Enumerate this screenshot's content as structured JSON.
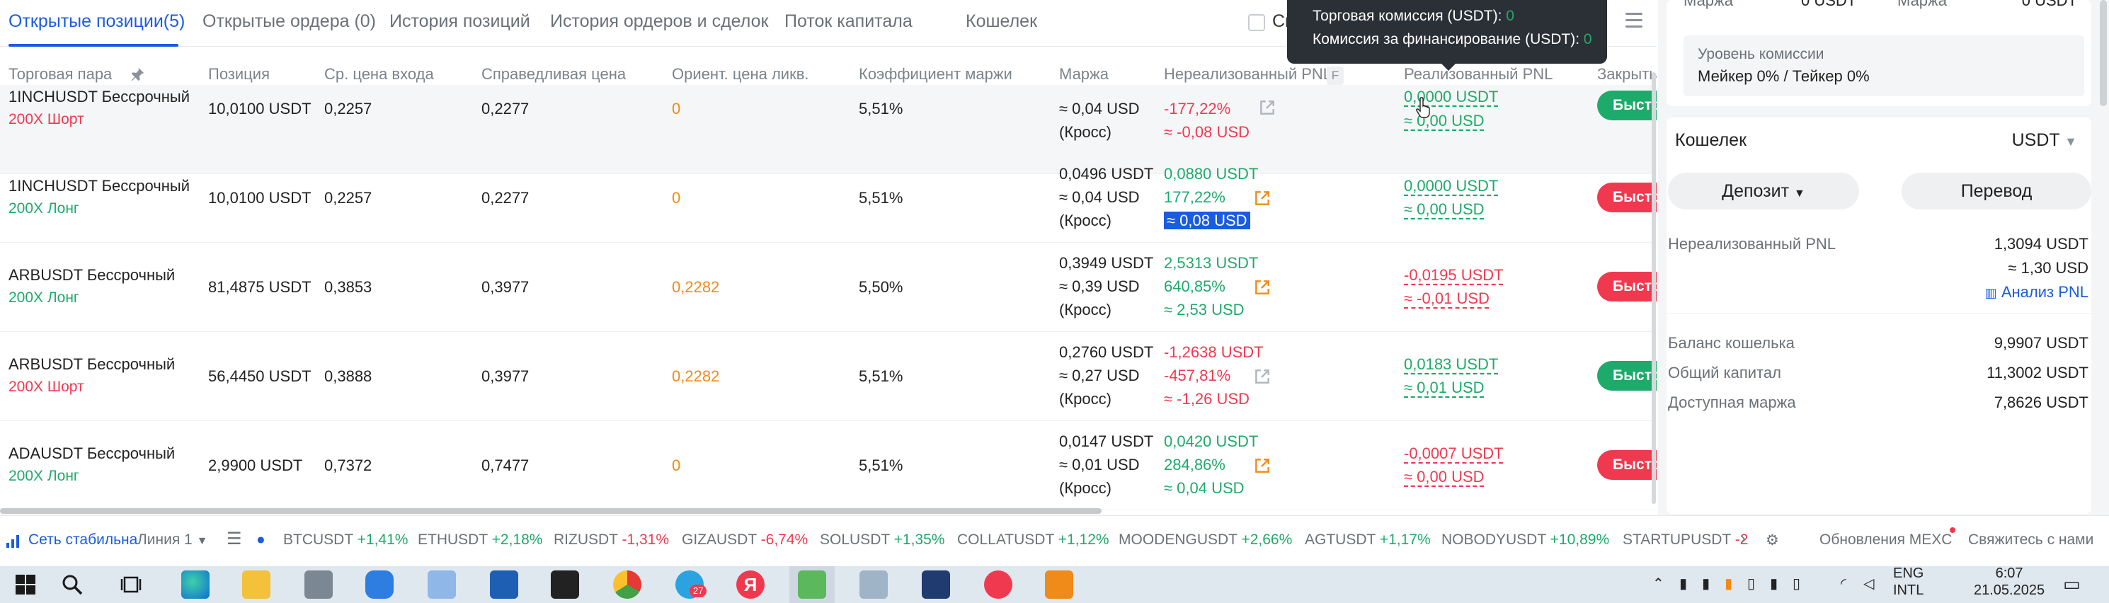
{
  "tabs": [
    {
      "label": "Открытые позиции(5)",
      "active": true
    },
    {
      "label": "Открытые ордера (0)"
    },
    {
      "label": "История позиций"
    },
    {
      "label": "История ордеров и сделок"
    },
    {
      "label": "Поток капитала"
    },
    {
      "label": "Кошелек"
    }
  ],
  "hide_label": "Ск",
  "columns": [
    "Торговая пара",
    "Позиция",
    "Ср. цена входа",
    "Справедливая цена",
    "Ориент. цена ликв.",
    "Коэффициент маржи",
    "Маржа",
    "Нереализованный PNL",
    "Реализованный PNL",
    "Закрыть"
  ],
  "f_badge": "F",
  "tooltip": {
    "line1_label": "Торговая комиссия (USDT):",
    "line1_value": "0",
    "line2_label": "Комиссия за финансирование (USDT):",
    "line2_value": "0"
  },
  "rows": [
    {
      "pair": "1INCHUSDT Бессрочный",
      "side": "200X Шорт",
      "size": "10,0100 USDT",
      "entry": "0,2257",
      "fair": "0,2277",
      "liq": "0",
      "ratio": "5,51%",
      "margin1": "",
      "margin2": "≈ 0,04 USD",
      "margin3": "(Кросс)",
      "upnl1": "-177,22%",
      "upnl2": "≈ -0,08 USD",
      "upnl3": "",
      "rpnl1": "0,0000 USDT",
      "rpnl2": "≈ 0,00 USD",
      "close": "Быстр"
    },
    {
      "pair": "1INCHUSDT Бессрочный",
      "side": "200X Лонг",
      "size": "10,0100 USDT",
      "entry": "0,2257",
      "fair": "0,2277",
      "liq": "0",
      "ratio": "5,51%",
      "margin1": "0,0496 USDT",
      "margin2": "≈ 0,04 USD",
      "margin3": "(Кросс)",
      "upnl1": "0,0880 USDT",
      "upnl2": "177,22%",
      "upnl3": "≈ 0,08 USD",
      "rpnl1": "0,0000 USDT",
      "rpnl2": "≈ 0,00 USD",
      "close": "Быстр"
    },
    {
      "pair": "ARBUSDT Бессрочный",
      "side": "200X Лонг",
      "size": "81,4875 USDT",
      "entry": "0,3853",
      "fair": "0,3977",
      "liq": "0,2282",
      "ratio": "5,50%",
      "margin1": "0,3949 USDT",
      "margin2": "≈ 0,39 USD",
      "margin3": "(Кросс)",
      "upnl1": "2,5313 USDT",
      "upnl2": "640,85%",
      "upnl3": "≈ 2,53 USD",
      "rpnl1": "-0,0195 USDT",
      "rpnl2": "≈ -0,01 USD",
      "close": "Быстр"
    },
    {
      "pair": "ARBUSDT Бессрочный",
      "side": "200X Шорт",
      "size": "56,4450 USDT",
      "entry": "0,3888",
      "fair": "0,3977",
      "liq": "0,2282",
      "ratio": "5,51%",
      "margin1": "0,2760 USDT",
      "margin2": "≈ 0,27 USD",
      "margin3": "(Кросс)",
      "upnl1": "-1,2638 USDT",
      "upnl2": "-457,81%",
      "upnl3": "≈ -1,26 USD",
      "rpnl1": "0,0183 USDT",
      "rpnl2": "≈ 0,01 USD",
      "close": "Быстр"
    },
    {
      "pair": "ADAUSDT Бессрочный",
      "side": "200X Лонг",
      "size": "2,9900 USDT",
      "entry": "0,7372",
      "fair": "0,7477",
      "liq": "0",
      "ratio": "5,51%",
      "margin1": "0,0147 USDT",
      "margin2": "≈ 0,01 USD",
      "margin3": "(Кросс)",
      "upnl1": "0,0420 USDT",
      "upnl2": "284,86%",
      "upnl3": "≈ 0,04 USD",
      "rpnl1": "-0,0007 USDT",
      "rpnl2": "≈ 0,00 USD",
      "close": "Быстр"
    }
  ],
  "right": {
    "top_label_left": "Маржа",
    "top_value_left": "0 USDT",
    "top_label_right": "Маржа",
    "top_value_right": "0 USDT",
    "fee_title": "Уровень комиссии",
    "fee_value": "Мейкер 0% / Тейкер 0%",
    "wallet_title": "Кошелек",
    "wallet_currency": "USDT",
    "deposit": "Депозит",
    "transfer": "Перевод",
    "upnl_label": "Нереализованный PNL",
    "upnl_value": "1,3094 USDT",
    "upnl_usd": "≈ 1,30 USD",
    "analysis": "Анализ PNL",
    "balance_label": "Баланс кошелька",
    "balance_value": "9,9907 USDT",
    "equity_label": "Общий капитал",
    "equity_value": "11,3002 USDT",
    "avail_label": "Доступная маржа",
    "avail_value": "7,8626 USDT"
  },
  "ticker": {
    "network": "Сеть стабильна",
    "line": "Линия 1",
    "items": [
      {
        "sym": "BTCUSDT",
        "chg": "+1,41%",
        "up": true
      },
      {
        "sym": "ETHUSDT",
        "chg": "+2,18%",
        "up": true
      },
      {
        "sym": "RIZUSDT",
        "chg": "-1,31%",
        "up": false
      },
      {
        "sym": "GIZAUSDT",
        "chg": "-6,74%",
        "up": false
      },
      {
        "sym": "SOLUSDT",
        "chg": "+1,35%",
        "up": true
      },
      {
        "sym": "COLLATUSDT",
        "chg": "+1,12%",
        "up": true
      },
      {
        "sym": "MOODENGUSDT",
        "chg": "+2,66%",
        "up": true
      },
      {
        "sym": "AGTUSDT",
        "chg": "+1,17%",
        "up": true
      },
      {
        "sym": "NOBODYUSDT",
        "chg": "+10,89%",
        "up": true
      },
      {
        "sym": "STARTUPUSDT",
        "chg": "-2",
        "up": false
      }
    ],
    "updates": "Обновления MEXC",
    "contact": "Свяжитесь с нами"
  },
  "taskbar": {
    "lang": "ENG",
    "layout": "INTL",
    "time": "6:07",
    "date": "21.05.2025",
    "telegram_badge": "27"
  }
}
